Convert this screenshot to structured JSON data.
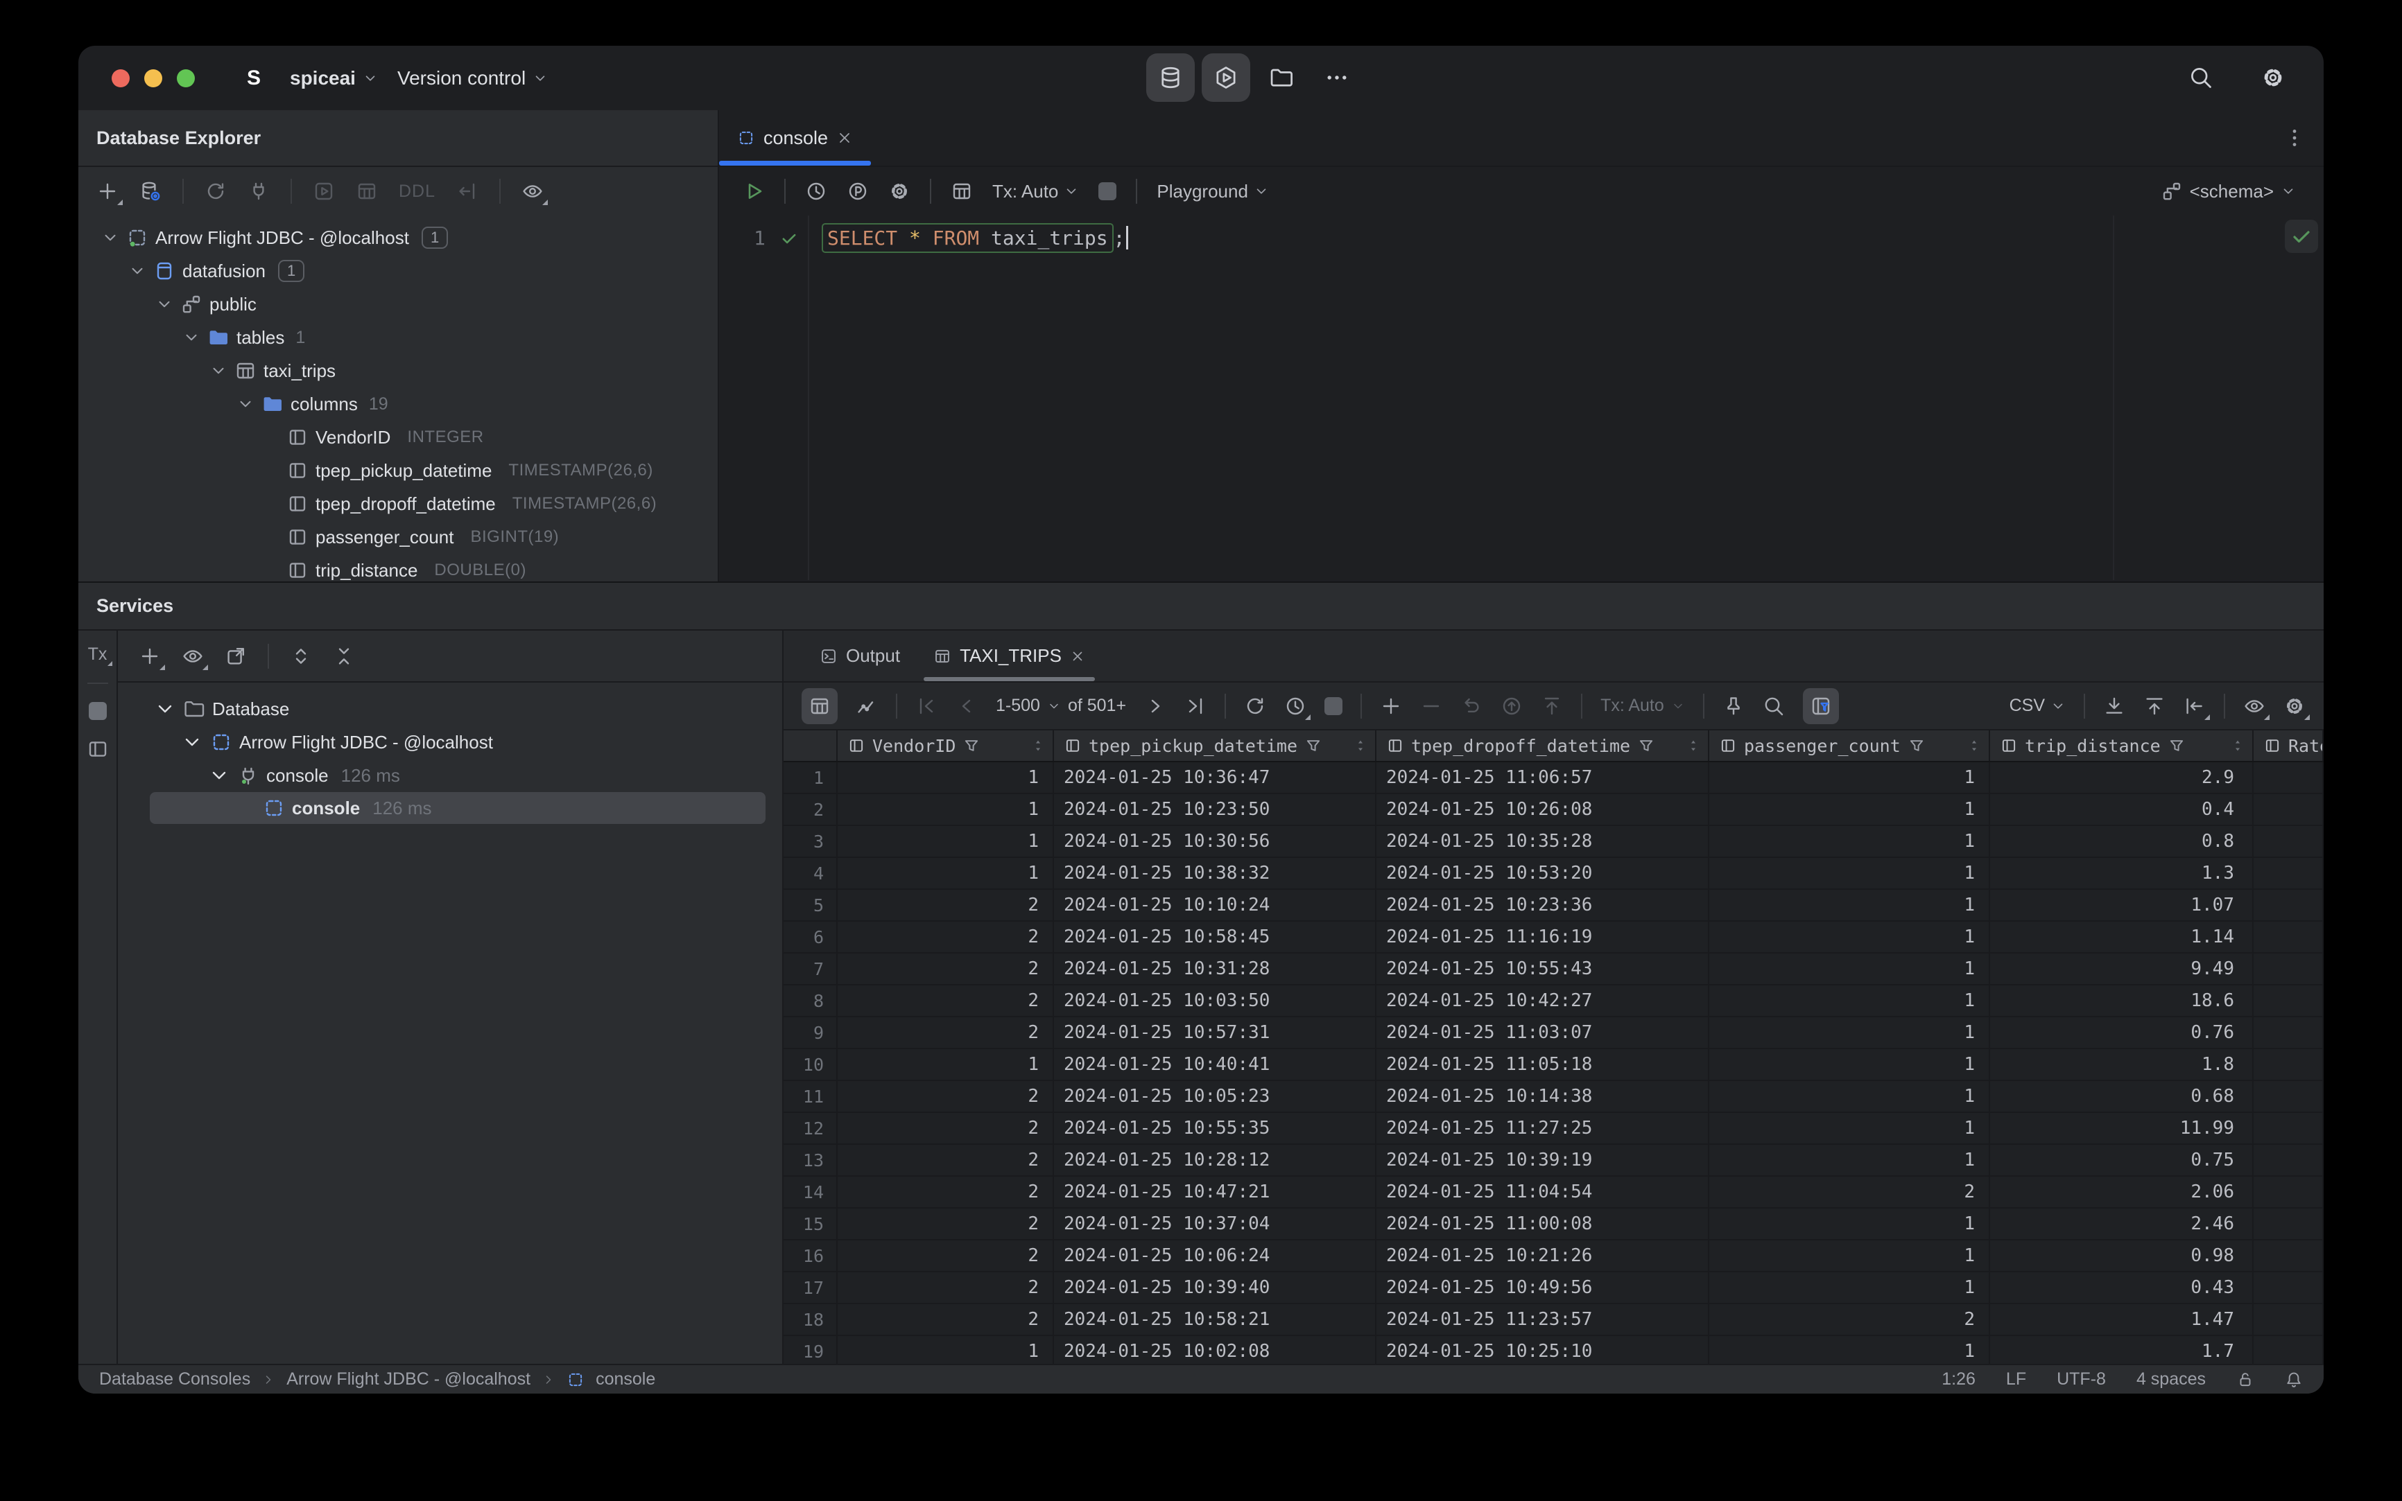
{
  "colors": {
    "accent_blue": "#3574f0",
    "run_green": "#57965c",
    "keyword_orange": "#cf8e6d",
    "traffic_red": "#ed6a5e",
    "traffic_yellow": "#f5bf4f",
    "traffic_green": "#62c554"
  },
  "titlebar": {
    "logo_letter": "S",
    "project": "spiceai",
    "menu_version_control": "Version control"
  },
  "explorer": {
    "title": "Database Explorer",
    "ddl_label": "DDL",
    "tree": [
      {
        "label": "Arrow Flight JDBC - @localhost",
        "badge": "1"
      },
      {
        "label": "datafusion",
        "badge": "1"
      },
      {
        "label": "public"
      },
      {
        "label": "tables",
        "count": "1"
      },
      {
        "label": "taxi_trips"
      },
      {
        "label": "columns",
        "count": "19"
      },
      {
        "label": "VendorID",
        "type": "INTEGER"
      },
      {
        "label": "tpep_pickup_datetime",
        "type": "TIMESTAMP(26,6)"
      },
      {
        "label": "tpep_dropoff_datetime",
        "type": "TIMESTAMP(26,6)"
      },
      {
        "label": "passenger_count",
        "type": "BIGINT(19)"
      },
      {
        "label": "trip_distance",
        "type": "DOUBLE(0)"
      }
    ]
  },
  "editor": {
    "tab_label": "console",
    "line_number": "1",
    "tx_mode": "Tx: Auto",
    "playground": "Playground",
    "schema": "<schema>",
    "sql": {
      "keyword1": "SELECT",
      "star": "*",
      "keyword2": "FROM",
      "identifier": "taxi_trips",
      "semicolon": ";"
    }
  },
  "services": {
    "title": "Services",
    "strip_tx": "Tx",
    "tree": [
      {
        "label": "Database"
      },
      {
        "label": "Arrow Flight JDBC - @localhost"
      },
      {
        "label": "console",
        "time": "126 ms"
      },
      {
        "label": "console",
        "time": "126 ms"
      }
    ]
  },
  "grid": {
    "tab_output": "Output",
    "tab_result": "TAXI_TRIPS",
    "pager_range": "1-500",
    "pager_total": "of 501+",
    "tx_mode": "Tx: Auto",
    "export_format": "CSV",
    "columns": [
      "VendorID",
      "tpep_pickup_datetime",
      "tpep_dropoff_datetime",
      "passenger_count",
      "trip_distance",
      "Rate"
    ],
    "rows": [
      [
        "1",
        "2024-01-25 10:36:47",
        "2024-01-25 11:06:57",
        "1",
        "2.9"
      ],
      [
        "1",
        "2024-01-25 10:23:50",
        "2024-01-25 10:26:08",
        "1",
        "0.4"
      ],
      [
        "1",
        "2024-01-25 10:30:56",
        "2024-01-25 10:35:28",
        "1",
        "0.8"
      ],
      [
        "1",
        "2024-01-25 10:38:32",
        "2024-01-25 10:53:20",
        "1",
        "1.3"
      ],
      [
        "2",
        "2024-01-25 10:10:24",
        "2024-01-25 10:23:36",
        "1",
        "1.07"
      ],
      [
        "2",
        "2024-01-25 10:58:45",
        "2024-01-25 11:16:19",
        "1",
        "1.14"
      ],
      [
        "2",
        "2024-01-25 10:31:28",
        "2024-01-25 10:55:43",
        "1",
        "9.49"
      ],
      [
        "2",
        "2024-01-25 10:03:50",
        "2024-01-25 10:42:27",
        "1",
        "18.6"
      ],
      [
        "2",
        "2024-01-25 10:57:31",
        "2024-01-25 11:03:07",
        "1",
        "0.76"
      ],
      [
        "1",
        "2024-01-25 10:40:41",
        "2024-01-25 11:05:18",
        "1",
        "1.8"
      ],
      [
        "2",
        "2024-01-25 10:05:23",
        "2024-01-25 10:14:38",
        "1",
        "0.68"
      ],
      [
        "2",
        "2024-01-25 10:55:35",
        "2024-01-25 11:27:25",
        "1",
        "11.99"
      ],
      [
        "2",
        "2024-01-25 10:28:12",
        "2024-01-25 10:39:19",
        "1",
        "0.75"
      ],
      [
        "2",
        "2024-01-25 10:47:21",
        "2024-01-25 11:04:54",
        "2",
        "2.06"
      ],
      [
        "2",
        "2024-01-25 10:37:04",
        "2024-01-25 11:00:08",
        "1",
        "2.46"
      ],
      [
        "2",
        "2024-01-25 10:06:24",
        "2024-01-25 10:21:26",
        "1",
        "0.98"
      ],
      [
        "2",
        "2024-01-25 10:39:40",
        "2024-01-25 10:49:56",
        "1",
        "0.43"
      ],
      [
        "2",
        "2024-01-25 10:58:21",
        "2024-01-25 11:23:57",
        "2",
        "1.47"
      ],
      [
        "1",
        "2024-01-25 10:02:08",
        "2024-01-25 10:25:10",
        "1",
        "1.7"
      ]
    ]
  },
  "statusbar": {
    "breadcrumb1": "Database Consoles",
    "breadcrumb2": "Arrow Flight JDBC - @localhost",
    "breadcrumb3": "console",
    "caret": "1:26",
    "line_ending": "LF",
    "encoding": "UTF-8",
    "indent": "4 spaces"
  }
}
